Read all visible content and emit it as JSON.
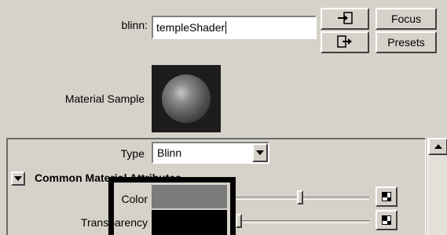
{
  "header": {
    "node_type_label": "blinn:",
    "node_name": "templeShader",
    "focus_label": "Focus",
    "presets_label": "Presets"
  },
  "icons": {
    "load_attributes": "arrow-into-box-icon",
    "copy_tab": "arrow-out-of-box-icon",
    "map_button": "checker-map-icon",
    "section_toggle": "triangle-down-icon",
    "scroll_up": "triangle-up-icon"
  },
  "material_sample": {
    "label": "Material Sample"
  },
  "attributes": {
    "type_label": "Type",
    "type_value": "Blinn",
    "section_title": "Common Material Attributes",
    "color_label": "Color",
    "color_value": "#7b7b7b",
    "color_slider_fraction": 0.48,
    "transparency_label": "Transparency",
    "transparency_value": "#000000",
    "transparency_slider_fraction": 0.0
  }
}
